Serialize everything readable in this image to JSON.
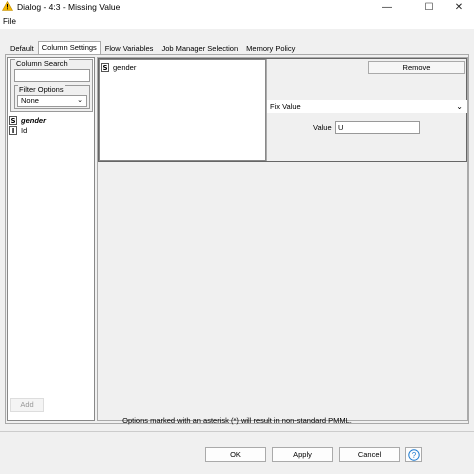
{
  "window": {
    "title": "Dialog - 4:3 - Missing Value",
    "icon": "warning-triangle-icon",
    "minimize_glyph": "—",
    "maximize_glyph": "☐",
    "close_glyph": "✕"
  },
  "menu": {
    "file": "File"
  },
  "tabs": [
    {
      "label": "Default",
      "active": false
    },
    {
      "label": "Column Settings",
      "active": true
    },
    {
      "label": "Flow Variables",
      "active": false
    },
    {
      "label": "Job Manager Selection",
      "active": false
    },
    {
      "label": "Memory Policy",
      "active": false
    }
  ],
  "column_search": {
    "legend": "Column Search",
    "value": "",
    "filter_options_legend": "Filter Options",
    "filter_selected": "None"
  },
  "columns": [
    {
      "type": "S",
      "name": "gender"
    },
    {
      "type": "I",
      "name": "Id"
    }
  ],
  "setting_row": {
    "column": {
      "type": "S",
      "name": "gender"
    },
    "remove_label": "Remove",
    "method": "Fix Value",
    "value_label": "Value",
    "value": "U"
  },
  "add_label": "Add",
  "note": "Options marked with an asterisk (*) will result in non-standard PMML.",
  "buttons": {
    "ok": "OK",
    "apply": "Apply",
    "cancel": "Cancel",
    "help": "?"
  },
  "colors": {
    "warning": "#f5b800",
    "help": "#1e7bd0",
    "window_bg": "#f0f0f0"
  }
}
